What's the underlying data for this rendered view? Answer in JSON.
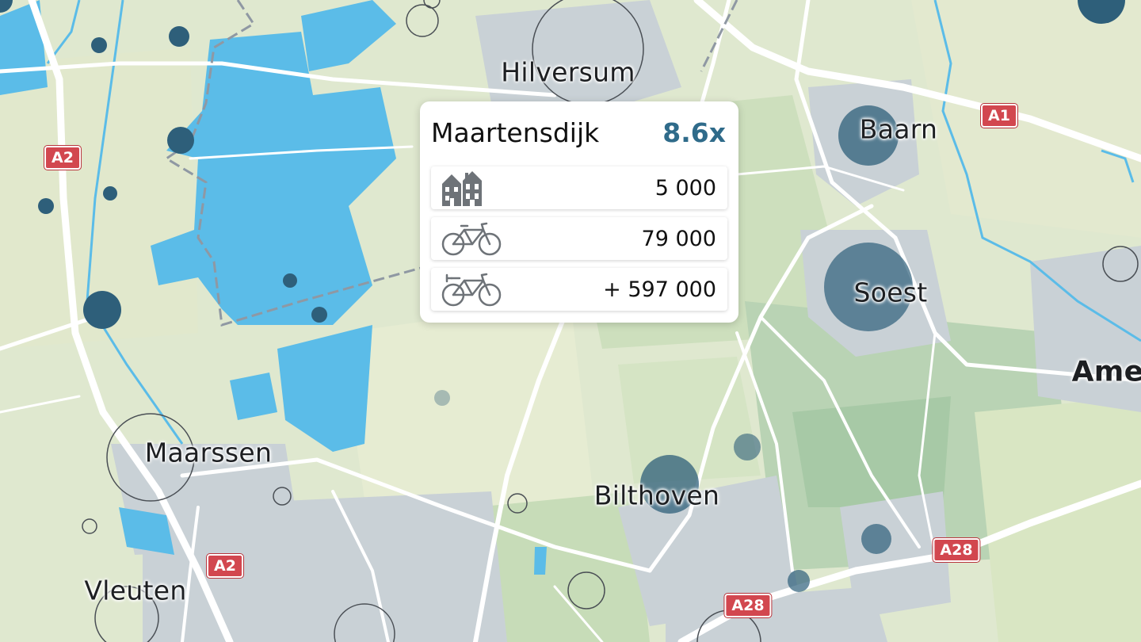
{
  "map": {
    "city_labels": [
      "Hilversum",
      "Baarn",
      "Soest",
      "Ame",
      "Maarssen",
      "Bilthoven",
      "Vleuten"
    ],
    "road_shields": [
      "A1",
      "A2",
      "A2",
      "A28",
      "A28"
    ]
  },
  "popup": {
    "place": "Maartensdijk",
    "ratio": "8.6x",
    "rows": [
      {
        "icon": "houses-icon",
        "value": "5 000"
      },
      {
        "icon": "bicycle-icon",
        "value": "79 000"
      },
      {
        "icon": "ebike-icon",
        "value": "+ 597 000"
      }
    ]
  },
  "colors": {
    "water": "#5bbce8",
    "urban": "#c8d0d6",
    "road": "#ffffff",
    "marker": "#2e5f7a",
    "ratio": "#2f6b8a",
    "shield": "#d2474f"
  }
}
